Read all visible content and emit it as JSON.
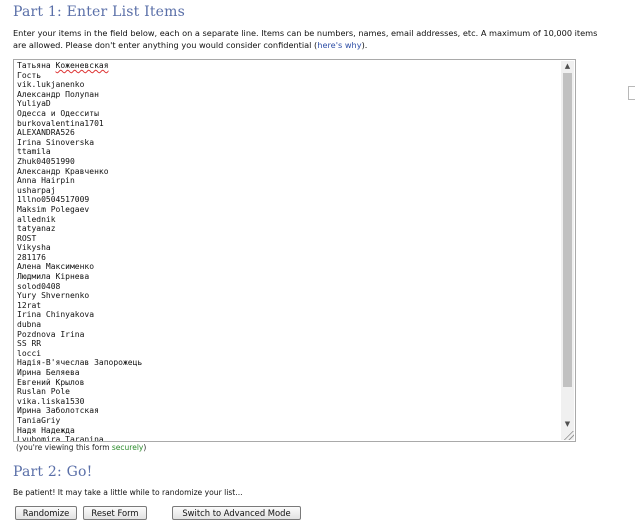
{
  "part1": {
    "heading": "Part 1: Enter List Items",
    "instructions_text": "Enter your items in the field below, each on a separate line. Items can be numbers, names, email addresses, etc. A maximum of 10,000 items are allowed. Please don't enter anything you would consider confidential (",
    "instructions_link": "here's why",
    "instructions_end": ")."
  },
  "list_items": [
    "Татьяна Коженевская",
    "Гость",
    "vik.lukjanenko",
    "Александр Полупан",
    "YuliyaD",
    "Одесса и Одесситы",
    "burkovalentina1701",
    "ALEXANDRA526",
    "Irina Sinoverska",
    "ttamila",
    "Zhuk04051990",
    "Александр Кравченко",
    "Anna Hairpin",
    "usharpaj",
    "1llno0504517009",
    "Maksim Polegaev",
    "allednik",
    "tatyanaz",
    "ROST",
    "Vikysha",
    "281176",
    "Алена Максименко",
    "Людмила Кірнева",
    "solod0408",
    "Yury Shvernenko",
    "12rat",
    "Irina Chinyakova",
    "dubna",
    "Pozdnova Irina",
    "SS RR",
    "locci",
    "Надія-В'ячеслав Запорожець",
    "Ирина Беляева",
    "Евгений Крылов",
    "Ruslan Pole",
    "vika.liska1530",
    "Ирина Заболотская",
    "TaniaGriy",
    "Надя Надежда",
    "Lyubomira Taranina"
  ],
  "secure_note": {
    "prefix": "(you're viewing this form ",
    "link": "securely",
    "suffix": ")"
  },
  "part2": {
    "heading": "Part 2: Go!",
    "patience_text": "Be patient! It may take a little while to randomize your list..."
  },
  "buttons": {
    "randomize": "Randomize",
    "reset": "Reset Form",
    "advanced": "Switch to Advanced Mode"
  },
  "colors": {
    "heading": "#5a6fa8",
    "link": "#2e4ea6",
    "secure_link": "#2a8a2a"
  },
  "icons": {
    "scroll_up": "▲",
    "scroll_down": "▼"
  }
}
